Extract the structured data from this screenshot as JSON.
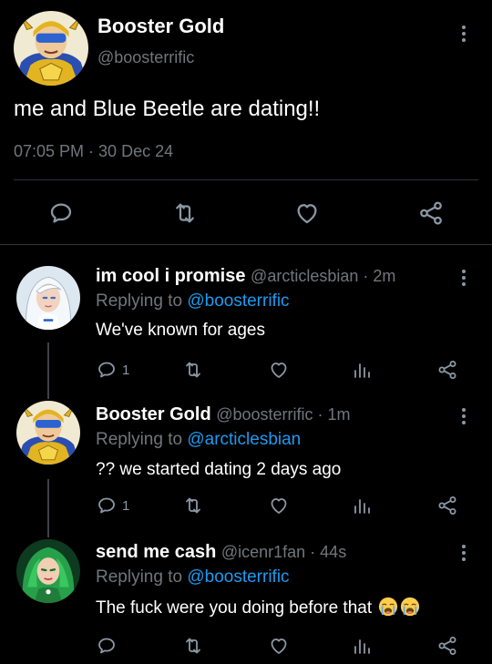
{
  "main_tweet": {
    "author_name": "Booster Gold",
    "handle": "@boosterrific",
    "text": "me and Blue Beetle are dating!!",
    "timestamp": "07:05 PM · 30 Dec 24",
    "avatar_icon": "booster-gold-avatar",
    "action_icons": [
      "reply-icon",
      "retweet-icon",
      "like-icon",
      "share-icon"
    ]
  },
  "replies": [
    {
      "author_name": "im cool i promise",
      "handle": "@arcticlesbian · 2m",
      "replying_prefix": "Replying to ",
      "replying_to": "@boosterrific",
      "text": "We've known for ages",
      "reply_count": "1",
      "avatar_icon": "white-haired-woman-avatar"
    },
    {
      "author_name": "Booster Gold",
      "handle": "@boosterrific · 1m",
      "replying_prefix": "Replying to ",
      "replying_to": "@arcticlesbian",
      "text": "?? we started dating 2 days ago",
      "reply_count": "1",
      "avatar_icon": "booster-gold-avatar"
    },
    {
      "author_name": "send me cash",
      "handle": "@icenr1fan · 44s",
      "replying_prefix": "Replying to ",
      "replying_to": "@boosterrific",
      "text": "The fuck were you doing before that",
      "reply_count": "",
      "emoji": [
        "loudly-crying-face",
        "loudly-crying-face"
      ],
      "avatar_icon": "green-haired-woman-avatar"
    }
  ],
  "colors": {
    "background": "#000000",
    "text_primary": "#ffffff",
    "text_secondary": "#71767b",
    "link": "#1d9bf0",
    "divider": "#2f3336",
    "icon": "#8b98a5"
  }
}
